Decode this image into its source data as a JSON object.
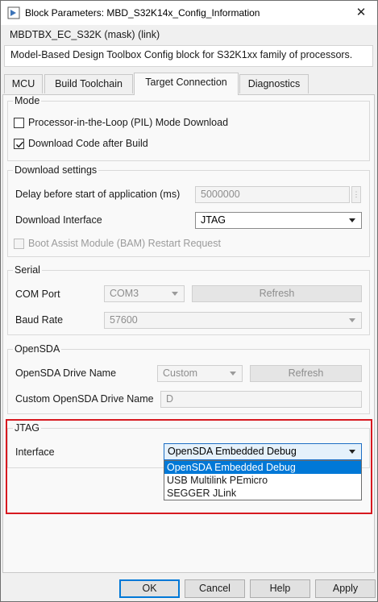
{
  "window": {
    "title": "Block Parameters: MBD_S32K14x_Config_Information",
    "subtitle": "MBDTBX_EC_S32K (mask) (link)",
    "description": "Model-Based Design Toolbox Config block for S32K1xx family of processors.",
    "close_glyph": "✕"
  },
  "tabs": [
    {
      "label": "MCU"
    },
    {
      "label": "Build Toolchain"
    },
    {
      "label": "Target Connection",
      "active": true
    },
    {
      "label": "Diagnostics"
    }
  ],
  "mode": {
    "title": "Mode",
    "pil_label": "Processor-in-the-Loop (PIL) Mode Download",
    "pil_checked": false,
    "download_label": "Download Code after Build",
    "download_checked": true
  },
  "download_settings": {
    "title": "Download settings",
    "delay_label": "Delay before start of application (ms)",
    "delay_value": "5000000",
    "spin_glyph": "⋮",
    "interface_label": "Download Interface",
    "interface_value": "JTAG",
    "bam_label": "Boot Assist Module (BAM) Restart Request",
    "bam_checked": false
  },
  "serial": {
    "title": "Serial",
    "com_label": "COM Port",
    "com_value": "COM3",
    "refresh_label": "Refresh",
    "baud_label": "Baud Rate",
    "baud_value": "57600"
  },
  "opensda": {
    "title": "OpenSDA",
    "drive_label": "OpenSDA Drive Name",
    "drive_value": "Custom",
    "refresh_label": "Refresh",
    "custom_label": "Custom OpenSDA Drive Name",
    "custom_value": "D"
  },
  "jtag": {
    "title": "JTAG",
    "interface_label": "Interface",
    "interface_value": "OpenSDA Embedded Debug",
    "options": [
      "OpenSDA Embedded Debug",
      "USB Multilink PEmicro",
      "SEGGER JLink"
    ],
    "highlighted_index": 0
  },
  "buttons": {
    "ok": "OK",
    "cancel": "Cancel",
    "help": "Help",
    "apply": "Apply"
  },
  "colors": {
    "highlight_box": "#d71920",
    "selection": "#0078d7"
  }
}
